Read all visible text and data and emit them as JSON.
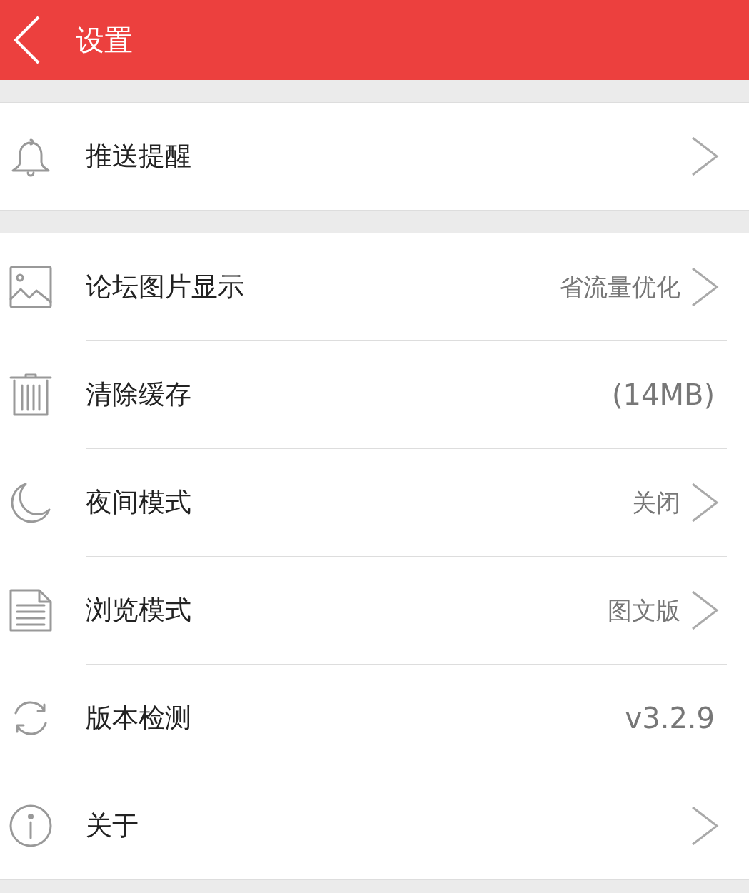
{
  "header": {
    "title": "设置"
  },
  "groups": [
    {
      "items": [
        {
          "label": "推送提醒",
          "chevron": true
        }
      ]
    },
    {
      "items": [
        {
          "label": "论坛图片显示",
          "value": "省流量优化",
          "chevron": true
        },
        {
          "label": "清除缓存",
          "value": "(14MB)",
          "chevron": false
        },
        {
          "label": "夜间模式",
          "value": "关闭",
          "chevron": true
        },
        {
          "label": "浏览模式",
          "value": "图文版",
          "chevron": true
        },
        {
          "label": "版本检测",
          "value": "v3.2.9",
          "chevron": false
        },
        {
          "label": "关于",
          "chevron": true
        }
      ]
    }
  ]
}
